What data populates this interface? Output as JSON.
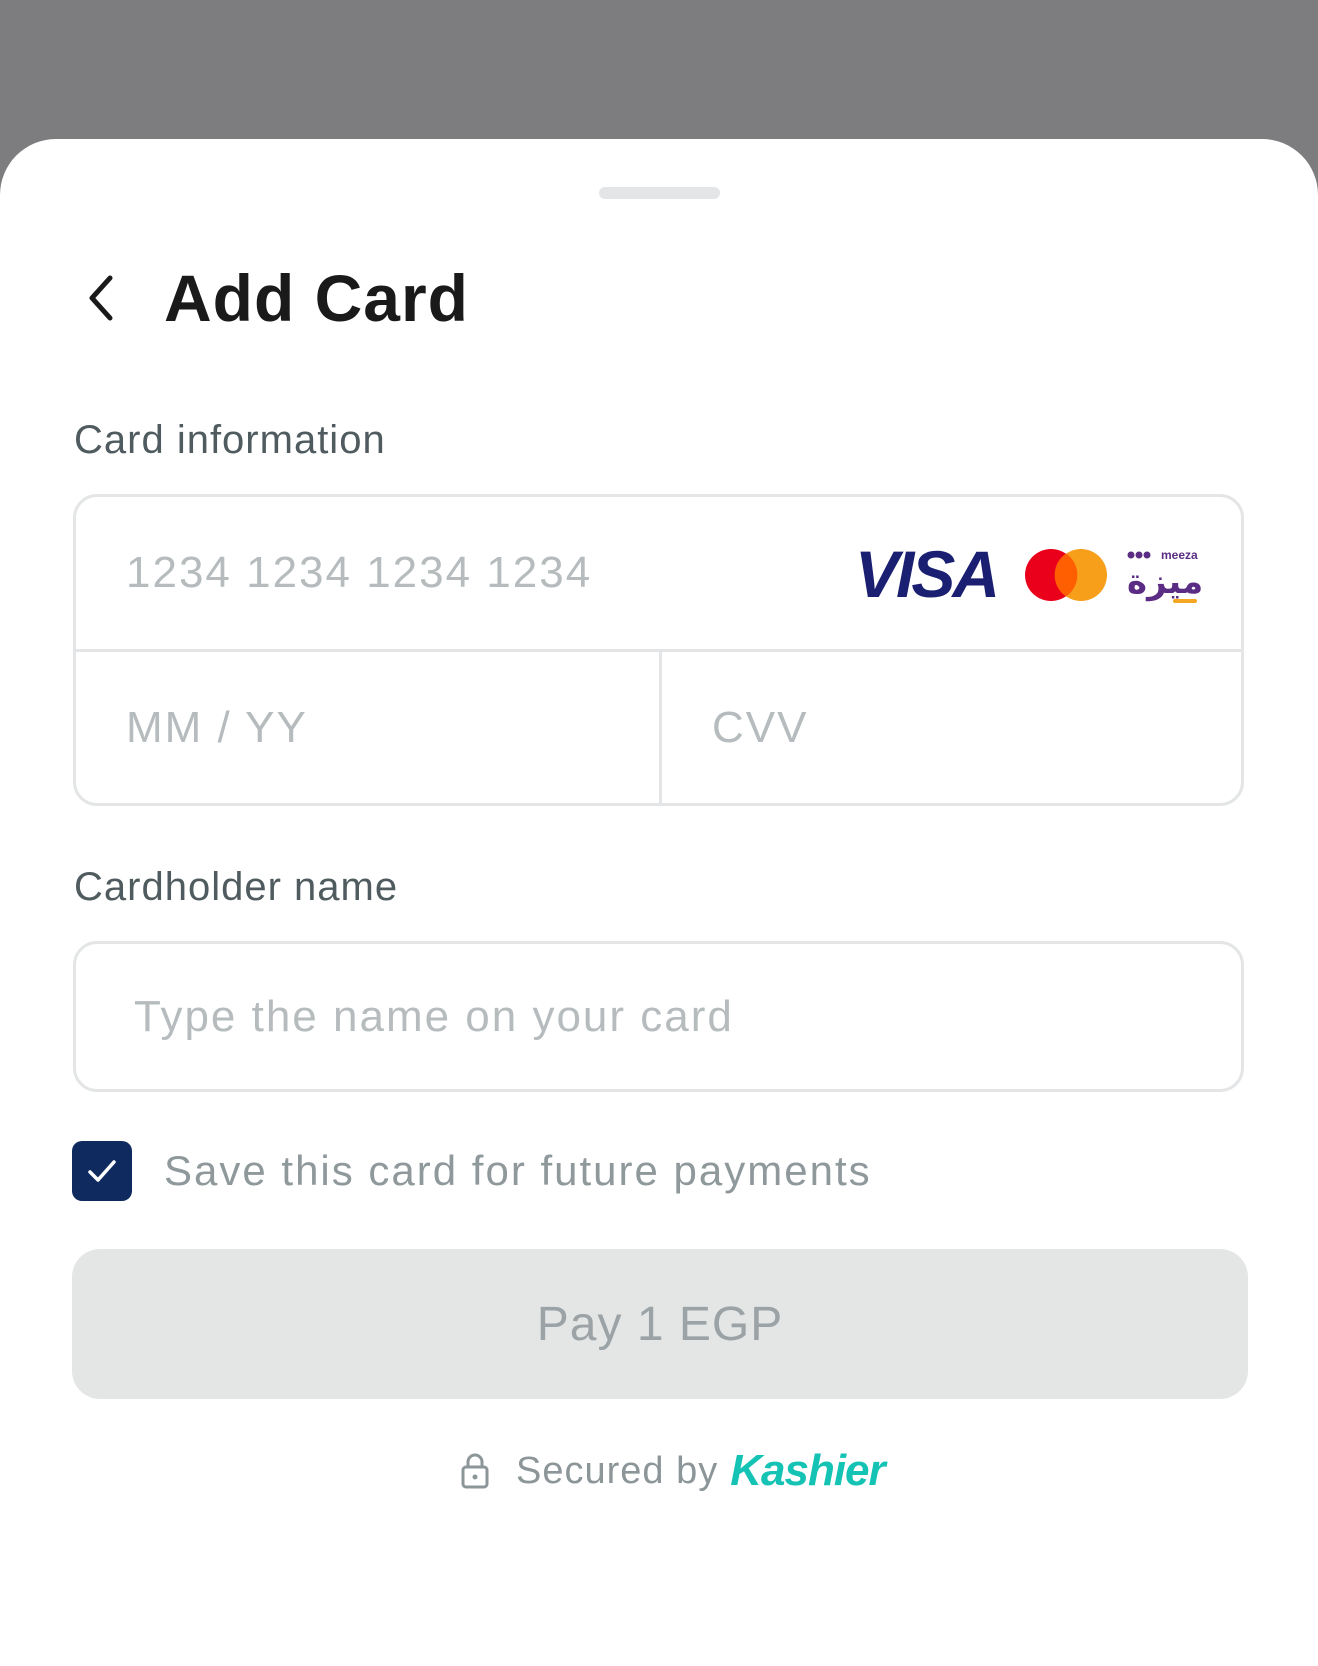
{
  "header": {
    "title": "Add Card",
    "back_icon": "chevron-left-icon"
  },
  "card_info": {
    "label": "Card information",
    "number_placeholder": "1234 1234 1234 1234",
    "expiry_placeholder": "MM / YY",
    "cvv_placeholder": "CVV",
    "brands": [
      "VISA",
      "Mastercard",
      "Meeza"
    ],
    "meeza_small": "meeza",
    "meeza_arabic": "ميزة"
  },
  "cardholder": {
    "label": "Cardholder name",
    "placeholder": "Type the name on your card"
  },
  "save_card": {
    "label": "Save this card for future payments",
    "checked": true
  },
  "pay_button": {
    "label": "Pay 1 EGP",
    "enabled": false
  },
  "footer": {
    "secured_text": "Secured by",
    "brand": "Kashier",
    "lock_icon": "lock-icon"
  },
  "colors": {
    "overlay": "#7d7d7f",
    "checkbox": "#0f2a5f",
    "kashier": "#14c3b4",
    "visa": "#1a1f71",
    "mastercard_red": "#eb001b",
    "mastercard_orange": "#f79e1b",
    "meeza_purple": "#5b2c83"
  }
}
